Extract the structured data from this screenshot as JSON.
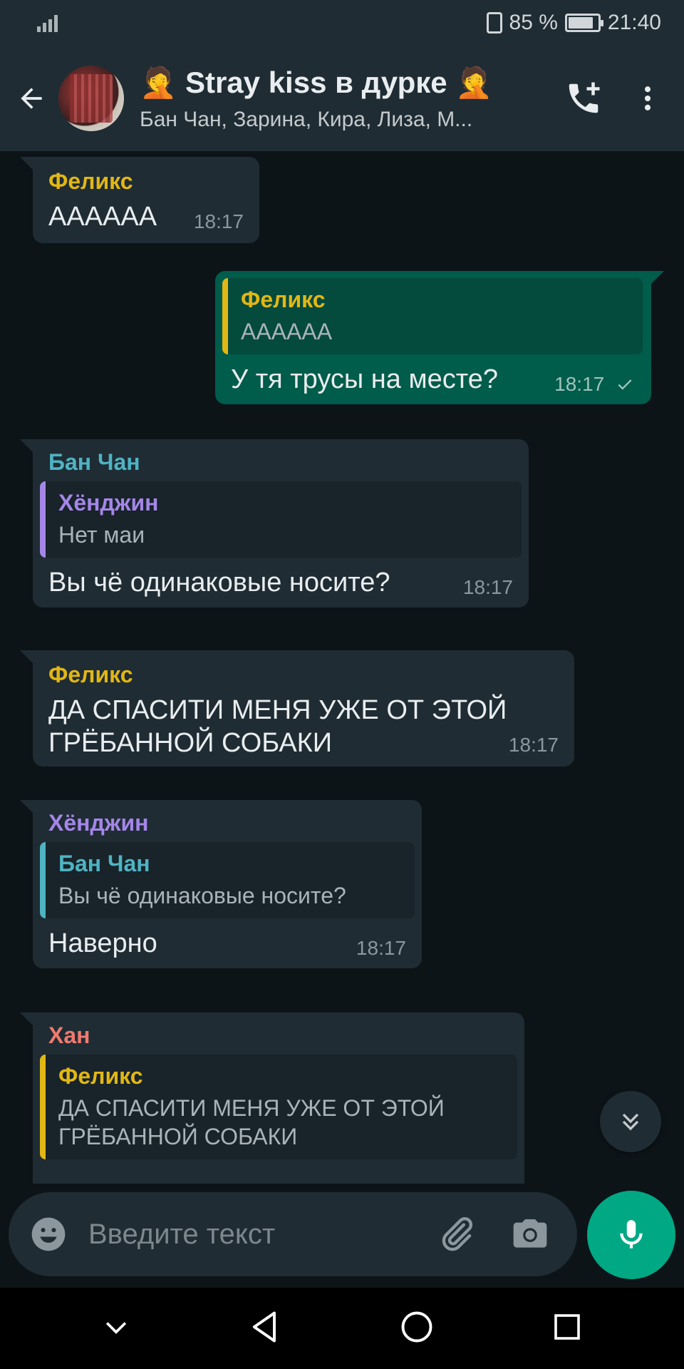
{
  "status_bar": {
    "battery": "85 %",
    "time": "21:40"
  },
  "header": {
    "title": "🤦 Stray kiss в дурке 🤦",
    "subtitle": "Бан Чан, Зарина, Кира, Лиза, М..."
  },
  "messages": [
    {
      "sender": "Феликс",
      "text": "АААААА",
      "time": "18:17"
    },
    {
      "quote_sender": "Феликс",
      "quote_text": "АААААА",
      "text": "У тя трусы на месте?",
      "time": "18:17"
    },
    {
      "sender": "Бан Чан",
      "quote_sender": "Хёнджин",
      "quote_text": "Нет маи",
      "text": "Вы чё одинаковые носите?",
      "time": "18:17"
    },
    {
      "sender": "Феликс",
      "text": "ДА СПАСИТИ МЕНЯ УЖЕ ОТ ЭТОЙ ГРЁБАННОЙ СОБАКИ",
      "time": "18:17"
    },
    {
      "sender": "Хёнджин",
      "quote_sender": "Бан Чан",
      "quote_text": "Вы чё одинаковые носите?",
      "text": "Наверно",
      "time": "18:17"
    },
    {
      "sender": "Хан",
      "quote_sender": "Феликс",
      "quote_text": "ДА СПАСИТИ МЕНЯ УЖЕ ОТ ЭТОЙ ГРЁБАННОЙ СОБАКИ"
    }
  ],
  "input": {
    "placeholder": "Введите текст"
  },
  "colors": {
    "felix": "#e2b714",
    "banchan": "#4fb3c2",
    "hyunjin": "#a586e8",
    "han": "#f07a6e",
    "outgoing": "#005c4b",
    "accent": "#00a884"
  },
  "icons": [
    "back-arrow-icon",
    "add-call-icon",
    "more-vertical-icon",
    "emoji-icon",
    "attach-icon",
    "camera-icon",
    "mic-icon",
    "scroll-down-icon",
    "check-icon"
  ]
}
